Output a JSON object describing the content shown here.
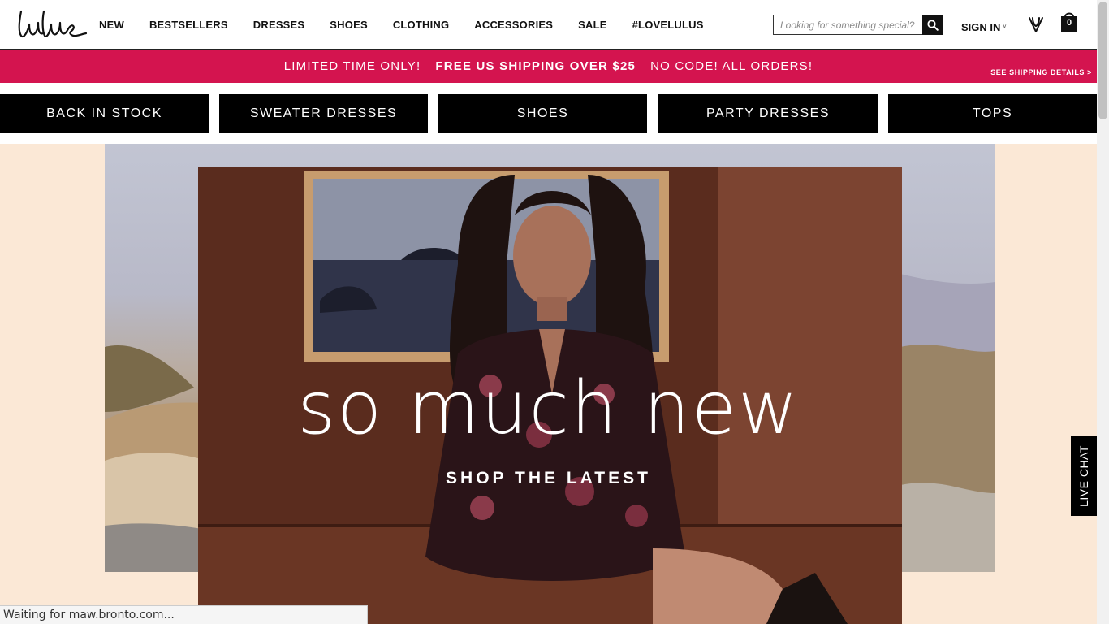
{
  "brand": {
    "logo_text": "lulus",
    "accent_color": "#d4144f"
  },
  "nav": {
    "items": [
      {
        "label": "NEW"
      },
      {
        "label": "BESTSELLERS"
      },
      {
        "label": "DRESSES"
      },
      {
        "label": "SHOES"
      },
      {
        "label": "CLOTHING"
      },
      {
        "label": "ACCESSORIES"
      },
      {
        "label": "SALE"
      },
      {
        "label": "#LOVELULUS"
      }
    ]
  },
  "search": {
    "placeholder": "Looking for something special?",
    "icon": "search-icon"
  },
  "account": {
    "signin_label": "SIGN IN",
    "caret": "˅"
  },
  "wishlist": {
    "icon": "heart-icon"
  },
  "cart": {
    "icon": "shopping-bag-icon",
    "count": "0"
  },
  "promo": {
    "part1": "LIMITED TIME ONLY!",
    "part2": "FREE US SHIPPING OVER $25",
    "part3": "NO CODE! ALL ORDERS!",
    "details_link": "SEE SHIPPING DETAILS >"
  },
  "categories": [
    {
      "label": "BACK IN STOCK"
    },
    {
      "label": "SWEATER DRESSES"
    },
    {
      "label": "SHOES"
    },
    {
      "label": "PARTY DRESSES"
    },
    {
      "label": "TOPS"
    }
  ],
  "hero": {
    "headline": "so much new",
    "cta": "SHOP THE LATEST"
  },
  "live_chat": {
    "label": "LIVE CHAT"
  },
  "status_bar": {
    "text": "Waiting for maw.bronto.com..."
  }
}
